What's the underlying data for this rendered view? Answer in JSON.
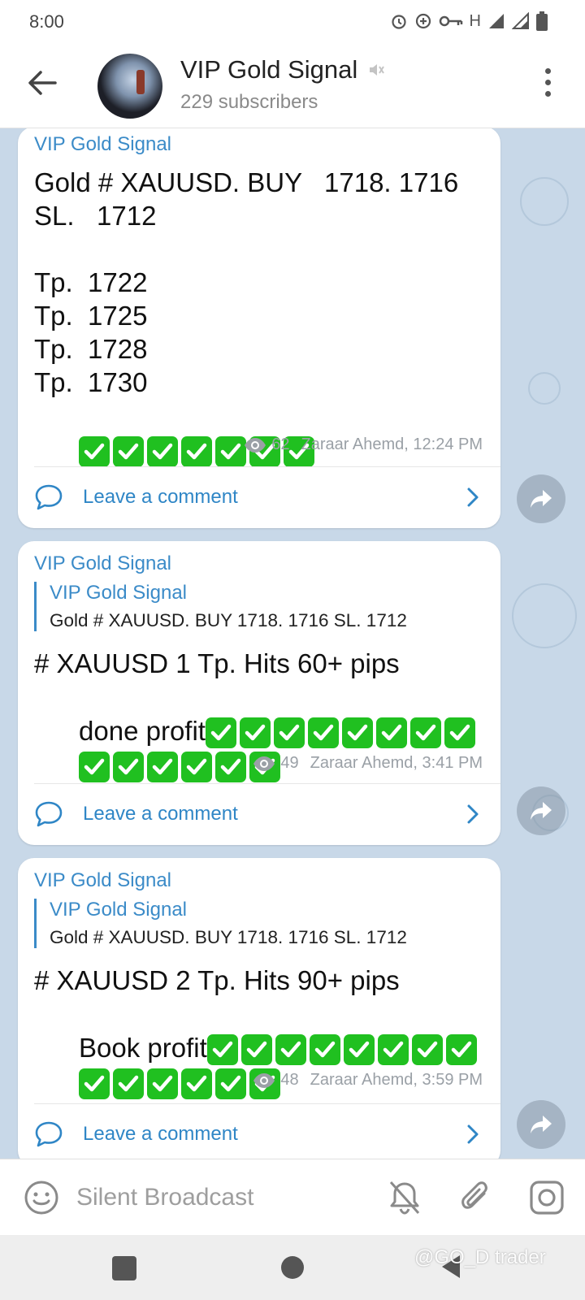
{
  "status_bar": {
    "time": "8:00",
    "icons": [
      "alarm-icon",
      "data-saver-icon",
      "vpn-key-icon",
      "signal-h-icon",
      "signal-icon",
      "signal-icon",
      "battery-icon"
    ],
    "network_label": "H"
  },
  "header": {
    "channel_name": "VIP Gold Signal",
    "subscribers": "229 subscribers",
    "muted": true
  },
  "messages": [
    {
      "sender": "VIP Gold Signal",
      "text": "Gold # XAUUSD. BUY   1718. 1716 SL.   1712\n\nTp.  1722\nTp.  1725\nTp.  1728\nTp.  1730",
      "check_count": 7,
      "views": "62",
      "author_time": "Zaraar Ahemd, 12:24 PM",
      "comment_label": "Leave a comment"
    },
    {
      "sender": "VIP Gold Signal",
      "reply_to": {
        "name": "VIP Gold Signal",
        "text": "Gold # XAUUSD. BUY   1718. 1716 SL.   1712"
      },
      "text_line1": "# XAUUSD 1 Tp. Hits 60+ pips",
      "text_line2": "done profit",
      "check_count_line2": 8,
      "check_count_line3": 6,
      "views": "49",
      "author_time": "Zaraar Ahemd, 3:41 PM",
      "comment_label": "Leave a comment"
    },
    {
      "sender": "VIP Gold Signal",
      "reply_to": {
        "name": "VIP Gold Signal",
        "text": "Gold # XAUUSD. BUY   1718. 1716 SL.   1712"
      },
      "text_line1": "# XAUUSD 2 Tp. Hits 90+ pips",
      "text_line2": "Book profit",
      "check_count_line2": 8,
      "check_count_line3": 6,
      "views": "48",
      "author_time": "Zaraar Ahemd, 3:59 PM",
      "comment_label": "Leave a comment"
    }
  ],
  "input_bar": {
    "placeholder": "Silent Broadcast",
    "icons": [
      "emoji-icon",
      "bell-off-icon",
      "attach-icon",
      "camera-icon"
    ]
  },
  "watermark": "@GO_D trader",
  "colors": {
    "accent": "#3b8bc8",
    "check_green": "#20c020",
    "chat_background": "#c8d8e8"
  }
}
